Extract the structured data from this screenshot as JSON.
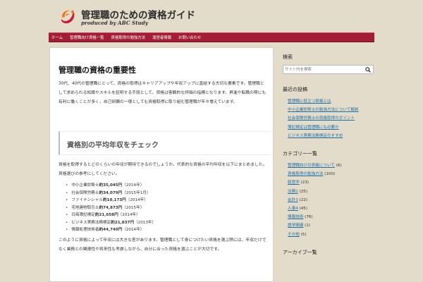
{
  "site": {
    "title": "管理職のための資格ガイド",
    "tagline": "produced by ABC Study",
    "brand_colors": {
      "logo_orange": "#f07a1a",
      "logo_red": "#c81e3a",
      "nav_bg": "#a21d35",
      "link": "#1d6fa8"
    }
  },
  "nav": {
    "items": [
      {
        "label": "ホーム"
      },
      {
        "label": "管理職向け資格一覧"
      },
      {
        "label": "資格取得の勉強方法"
      },
      {
        "label": "運営者情報"
      },
      {
        "label": "お問い合わせ"
      }
    ]
  },
  "article": {
    "title": "管理職の資格の重要性",
    "para1": "30代、40代の管理職にとって、資格の取得はキャリアアップや年収アップに直結する大切な要素です。管理職として求められる知識やスキルを証明する手段として、資格は客観的な評価の指標となります。昇進や転職の際にも有利に働くことが多く、自己研鑽の一環としても資格取得に取り組む管理職が年々増えています。",
    "section_title": "資格別の平均年収をチェック",
    "para2": "資格を取得するとどのくらいの年収が期待できるのでしょうか。代表的な資格の平均年収を以下にまとめました。資格選びの参考にしてください。",
    "salaries": [
      {
        "name": "中小企業診断士",
        "amount": "約35,045円",
        "year": "（2014年）"
      },
      {
        "name": "社会保険労務士",
        "amount": "約34,079円",
        "year": "（2015年1月）"
      },
      {
        "name": "ファイナンシャル",
        "amount": "約10,173円",
        "year": "（2014年）"
      },
      {
        "name": "宅地建物取引士",
        "amount": "約74,873円",
        "year": "（2015年）"
      },
      {
        "name": "日商簿記検定",
        "amount": "約21,658円",
        "year": "（2014年）"
      },
      {
        "name": "ビジネス実務法務検定",
        "amount": "約21,837円",
        "year": "（2013年）"
      },
      {
        "name": "情報処理技術者",
        "amount": "約44,740円",
        "year": "（2014年）"
      }
    ],
    "para3": "このように資格によって年収には大きな差があります。管理職として身につけたい資格を選ぶ際には、年収だけでなく業務との関連性や将来性も考慮しながら、自分に合った資格を選ぶことが大切です。"
  },
  "sidebar": {
    "search": {
      "title": "検索",
      "placeholder": "サイト内を検索"
    },
    "recent": {
      "title": "最近の投稿",
      "items": [
        {
          "label": "管理職に役立つ資格とは"
        },
        {
          "label": "中小企業診断士の勉強方法について解説"
        },
        {
          "label": "社会保険労務士の資格取得のポイント"
        },
        {
          "label": "簿記検定は管理職にも必要か"
        },
        {
          "label": "ビジネス実務法務検定のすすめ"
        }
      ]
    },
    "categories": {
      "title": "カテゴリー一覧",
      "items": [
        {
          "label": "管理職向けの資格について",
          "count": "(6)"
        },
        {
          "label": "資格取得の勉強方法",
          "count": "(100)"
        },
        {
          "label": "経営学",
          "count": "(23)"
        },
        {
          "label": "法務2",
          "count": "(25)"
        },
        {
          "label": "会計3",
          "count": "(22)"
        },
        {
          "label": "人事4",
          "count": "(45)"
        },
        {
          "label": "情報技術",
          "count": "(76)"
        },
        {
          "label": "語学関連",
          "count": "(1)"
        },
        {
          "label": "その他",
          "count": "(5)"
        }
      ]
    },
    "archive": {
      "title": "アーカイブ一覧"
    }
  }
}
